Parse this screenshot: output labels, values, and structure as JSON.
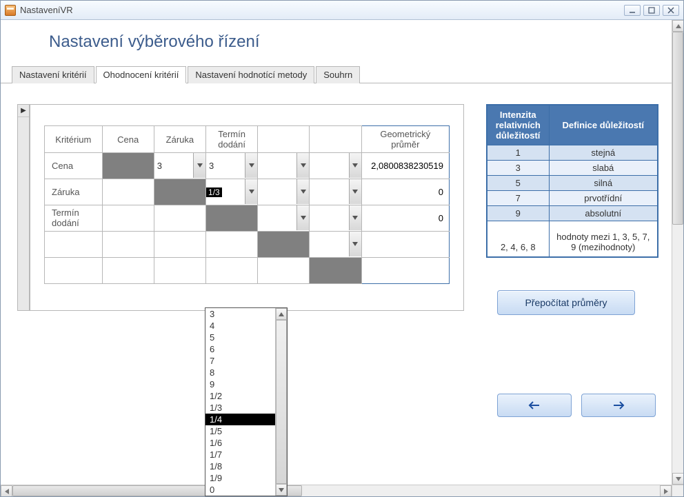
{
  "window": {
    "title": "NastaveníVR"
  },
  "header": {
    "page_title": "Nastavení výběrového řízení"
  },
  "tabs": [
    {
      "label": "Nastavení kritérií",
      "active": false
    },
    {
      "label": "Ohodnocení kritérií",
      "active": true
    },
    {
      "label": "Nastavení hodnotící metody",
      "active": false
    },
    {
      "label": "Souhrn",
      "active": false
    }
  ],
  "criteria_table": {
    "row_header_label": "Kritérium",
    "col_headers": [
      "Cena",
      "Záruka",
      "Termín dodání",
      "",
      ""
    ],
    "geo_mean_header": "Geometrický průměr",
    "rows": [
      {
        "label": "Cena",
        "cells": [
          null,
          "3",
          "3",
          "",
          ""
        ],
        "geo": "2,0800838230519"
      },
      {
        "label": "Záruka",
        "cells": [
          "",
          null,
          "1/3",
          "",
          ""
        ],
        "geo": "0"
      },
      {
        "label": "Termín dodání",
        "cells": [
          "",
          "",
          null,
          "",
          ""
        ],
        "geo": "0"
      },
      {
        "label": "",
        "cells": [
          "",
          "",
          "",
          null,
          ""
        ],
        "geo": ""
      },
      {
        "label": "",
        "cells": [
          "",
          "",
          "",
          "",
          null
        ],
        "geo": ""
      }
    ],
    "editing_cell_value": "1/3"
  },
  "dropdown": {
    "items": [
      "3",
      "4",
      "5",
      "6",
      "7",
      "8",
      "9",
      "1/2",
      "1/3",
      "1/4",
      "1/5",
      "1/6",
      "1/7",
      "1/8",
      "1/9",
      "0"
    ],
    "highlighted": "1/4"
  },
  "intensity_table": {
    "head1": "Intenzita relativních důležitostí",
    "head2": "Definice důležitostí",
    "rows": [
      {
        "k": "1",
        "v": "stejná"
      },
      {
        "k": "3",
        "v": "slabá"
      },
      {
        "k": "5",
        "v": "silná"
      },
      {
        "k": "7",
        "v": "prvotřídní"
      },
      {
        "k": "9",
        "v": "absolutní"
      }
    ],
    "footer": {
      "k": "2, 4, 6, 8",
      "v": "hodnoty mezi  1, 3, 5, 7, 9 (mezihodnoty)"
    }
  },
  "buttons": {
    "recalc": "Přepočítat průměry"
  }
}
